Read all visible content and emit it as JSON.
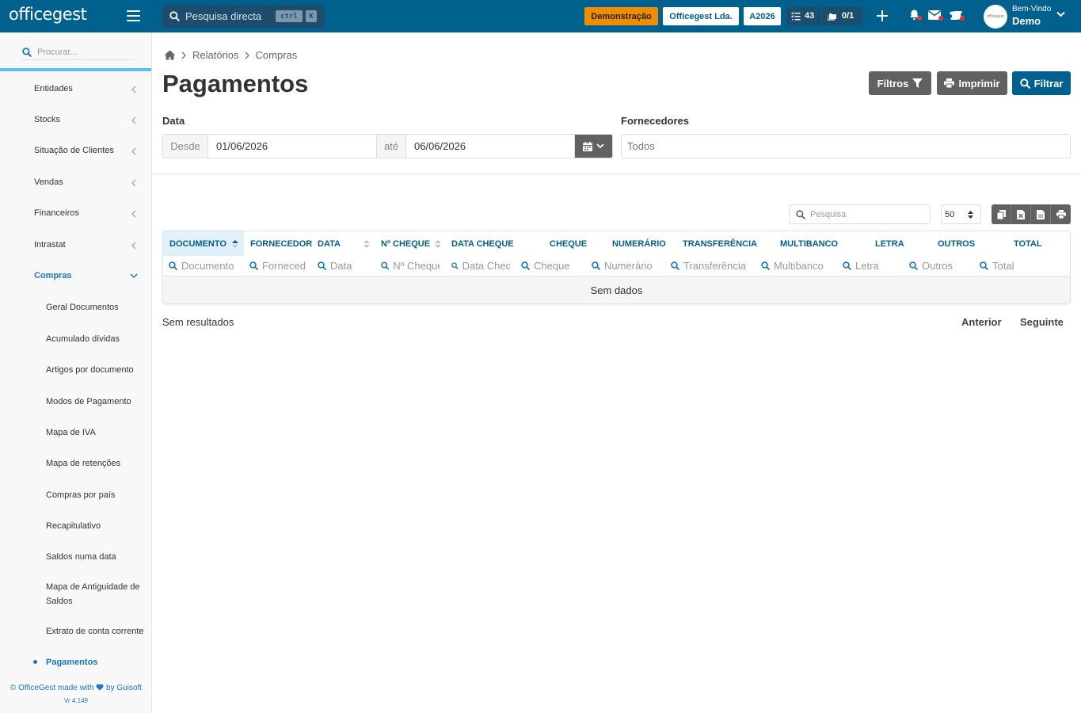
{
  "app": {
    "logo": "officegest",
    "quick_search_label": "Pesquisa directa",
    "shortcut_ctrl": "ctrl",
    "shortcut_key": "K",
    "mode_badge": "Demonstração",
    "company": "Officegest Lda.",
    "year": "A2026",
    "tasks_count": "43",
    "docs_count": "0/1",
    "welcome": "Bem-Vindo",
    "user": "Demo",
    "avatar_text": "officegest"
  },
  "sidebar": {
    "search_placeholder": "Procurar...",
    "items": [
      {
        "label": "Entidades"
      },
      {
        "label": "Stocks"
      },
      {
        "label": "Situação de Clientes"
      },
      {
        "label": "Vendas"
      },
      {
        "label": "Financeiros"
      },
      {
        "label": "Intrastat"
      },
      {
        "label": "Compras"
      }
    ],
    "subitems": [
      {
        "label": "Geral Documentos"
      },
      {
        "label": "Acumulado dívidas"
      },
      {
        "label": "Artigos por documento"
      },
      {
        "label": "Modos de Pagamento"
      },
      {
        "label": "Mapa de IVA"
      },
      {
        "label": "Mapa de retenções"
      },
      {
        "label": "Compras por país"
      },
      {
        "label": "Recapitulativo"
      },
      {
        "label": "Saldos numa data"
      },
      {
        "label": "Mapa de Antiguidade de Saldos"
      },
      {
        "label": "Extrato de conta corrente"
      },
      {
        "label": "Pagamentos"
      }
    ],
    "footer_prefix": "© OfficeGest made with",
    "footer_suffix": "by Guisoft",
    "version": "Vr 4.149"
  },
  "breadcrumb": {
    "items": [
      "Relatórios",
      "Compras"
    ]
  },
  "page": {
    "title": "Pagamentos",
    "buttons": {
      "filters": "Filtros",
      "print": "Imprimir",
      "filter": "Filtrar"
    }
  },
  "filters": {
    "date_label": "Data",
    "from_label": "Desde",
    "from_value": "01/06/2026",
    "to_label": "até",
    "to_value": "06/06/2026",
    "suppliers_label": "Fornecedores",
    "suppliers_value": "Todos"
  },
  "table": {
    "search_placeholder": "Pesquisa",
    "page_size": "50",
    "columns": [
      {
        "header": "DOCUMENTO",
        "filter": "Documento"
      },
      {
        "header": "FORNECEDOR",
        "filter": "Forneced"
      },
      {
        "header": "DATA",
        "filter": "Data"
      },
      {
        "header": "Nº CHEQUE",
        "filter": "Nº Cheque"
      },
      {
        "header": "DATA CHEQUE",
        "filter": "Data Cheque"
      },
      {
        "header": "CHEQUE",
        "filter": "Cheque"
      },
      {
        "header": "NUMERÁRIO",
        "filter": "Numerário"
      },
      {
        "header": "TRANSFERÊNCIA",
        "filter": "Transferência"
      },
      {
        "header": "MULTIBANCO",
        "filter": "Multibanco"
      },
      {
        "header": "LETRA",
        "filter": "Letra"
      },
      {
        "header": "OUTROS",
        "filter": "Outros"
      },
      {
        "header": "TOTAL",
        "filter": "Total"
      }
    ],
    "empty_message": "Sem dados",
    "results_text": "Sem resultados",
    "prev": "Anterior",
    "next": "Seguinte"
  },
  "colors": {
    "brand": "#00608e",
    "accent": "#5bc0eb",
    "demo_badge": "#f08c00",
    "active_link": "#1976c6"
  }
}
